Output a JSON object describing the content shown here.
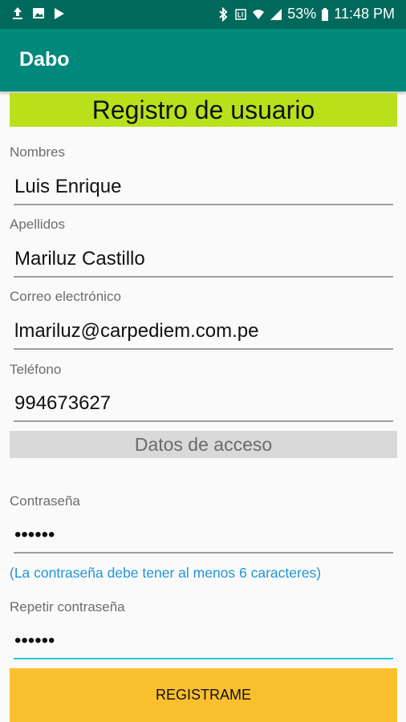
{
  "status_bar": {
    "battery": "53%",
    "time": "11:48 PM",
    "left_icons": [
      "upload-icon",
      "image-icon",
      "play-store-icon"
    ],
    "right_icons": [
      "bluetooth-icon",
      "lte-icon",
      "wifi-icon",
      "signal-icon",
      "battery-icon"
    ]
  },
  "app": {
    "title": "Dabo"
  },
  "form": {
    "heading": "Registro de usuario",
    "fields": [
      {
        "label": "Nombres",
        "value": "Luis Enrique"
      },
      {
        "label": "Apellidos",
        "value": "Mariluz Castillo"
      },
      {
        "label": "Correo electrónico",
        "value": "lmariluz@carpediem.com.pe"
      },
      {
        "label": "Teléfono",
        "value": "994673627"
      }
    ],
    "access_section": "Datos de acceso",
    "password": {
      "label": "Contraseña",
      "value": "qwerty"
    },
    "password_hint": "(La contraseña debe tener al menos 6 caracteres)",
    "repeat_password": {
      "label": "Repetir contraseña",
      "value": "qwerty"
    },
    "submit_label": "REGISTRAME"
  },
  "colors": {
    "status_bar": "#00695c",
    "app_bar": "#00897b",
    "heading_bg": "#b8e11c",
    "section_bg": "#d9d9d9",
    "hint": "#2196d6",
    "button": "#fbc02d",
    "active_underline": "#26c6da"
  }
}
